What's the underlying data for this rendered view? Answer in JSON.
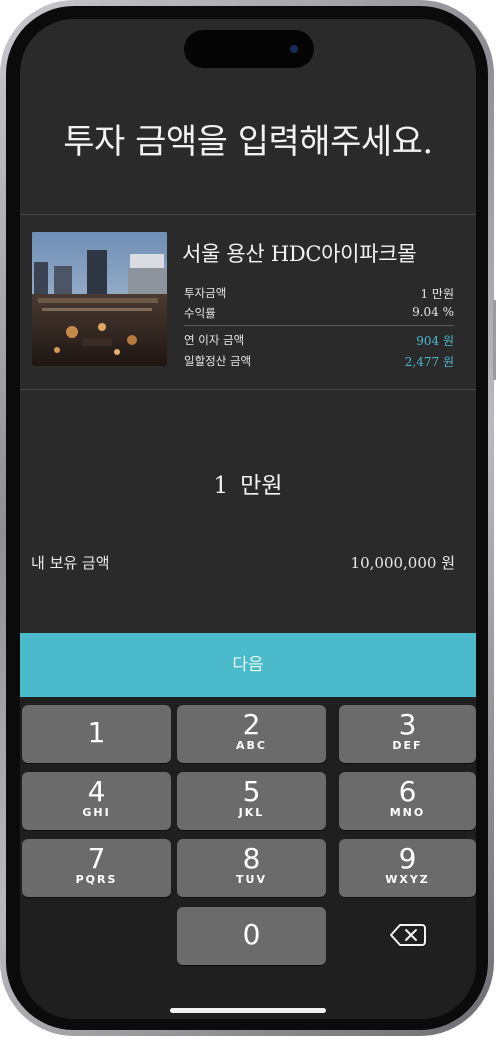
{
  "page_title": "투자 금액을 입력해주세요.",
  "product": {
    "name": "서울 용산 HDC아이파크몰",
    "rows": [
      {
        "label": "투자금액",
        "value": "1 만원"
      },
      {
        "label": "수익률",
        "value": "9.04 %"
      }
    ],
    "calc_rows": [
      {
        "label": "연 이자 금액",
        "value": "904 원"
      },
      {
        "label": "일할정산 금액",
        "value": "2,477 원"
      }
    ]
  },
  "amount": {
    "value": "1",
    "unit": "만원"
  },
  "holding": {
    "label": "내 보유 금액",
    "value": "10,000,000 원"
  },
  "next_label": "다음",
  "keypad": [
    {
      "num": "1",
      "letters": ""
    },
    {
      "num": "2",
      "letters": "ABC"
    },
    {
      "num": "3",
      "letters": "DEF"
    },
    {
      "num": "4",
      "letters": "GHI"
    },
    {
      "num": "5",
      "letters": "JKL"
    },
    {
      "num": "6",
      "letters": "MNO"
    },
    {
      "num": "7",
      "letters": "PQRS"
    },
    {
      "num": "8",
      "letters": "TUV"
    },
    {
      "num": "9",
      "letters": "WXYZ"
    },
    {
      "num": "0",
      "letters": ""
    }
  ],
  "colors": {
    "accent": "#4bbacb",
    "screen_bg": "#2a2a2a",
    "key_bg": "#6b6b6b"
  }
}
